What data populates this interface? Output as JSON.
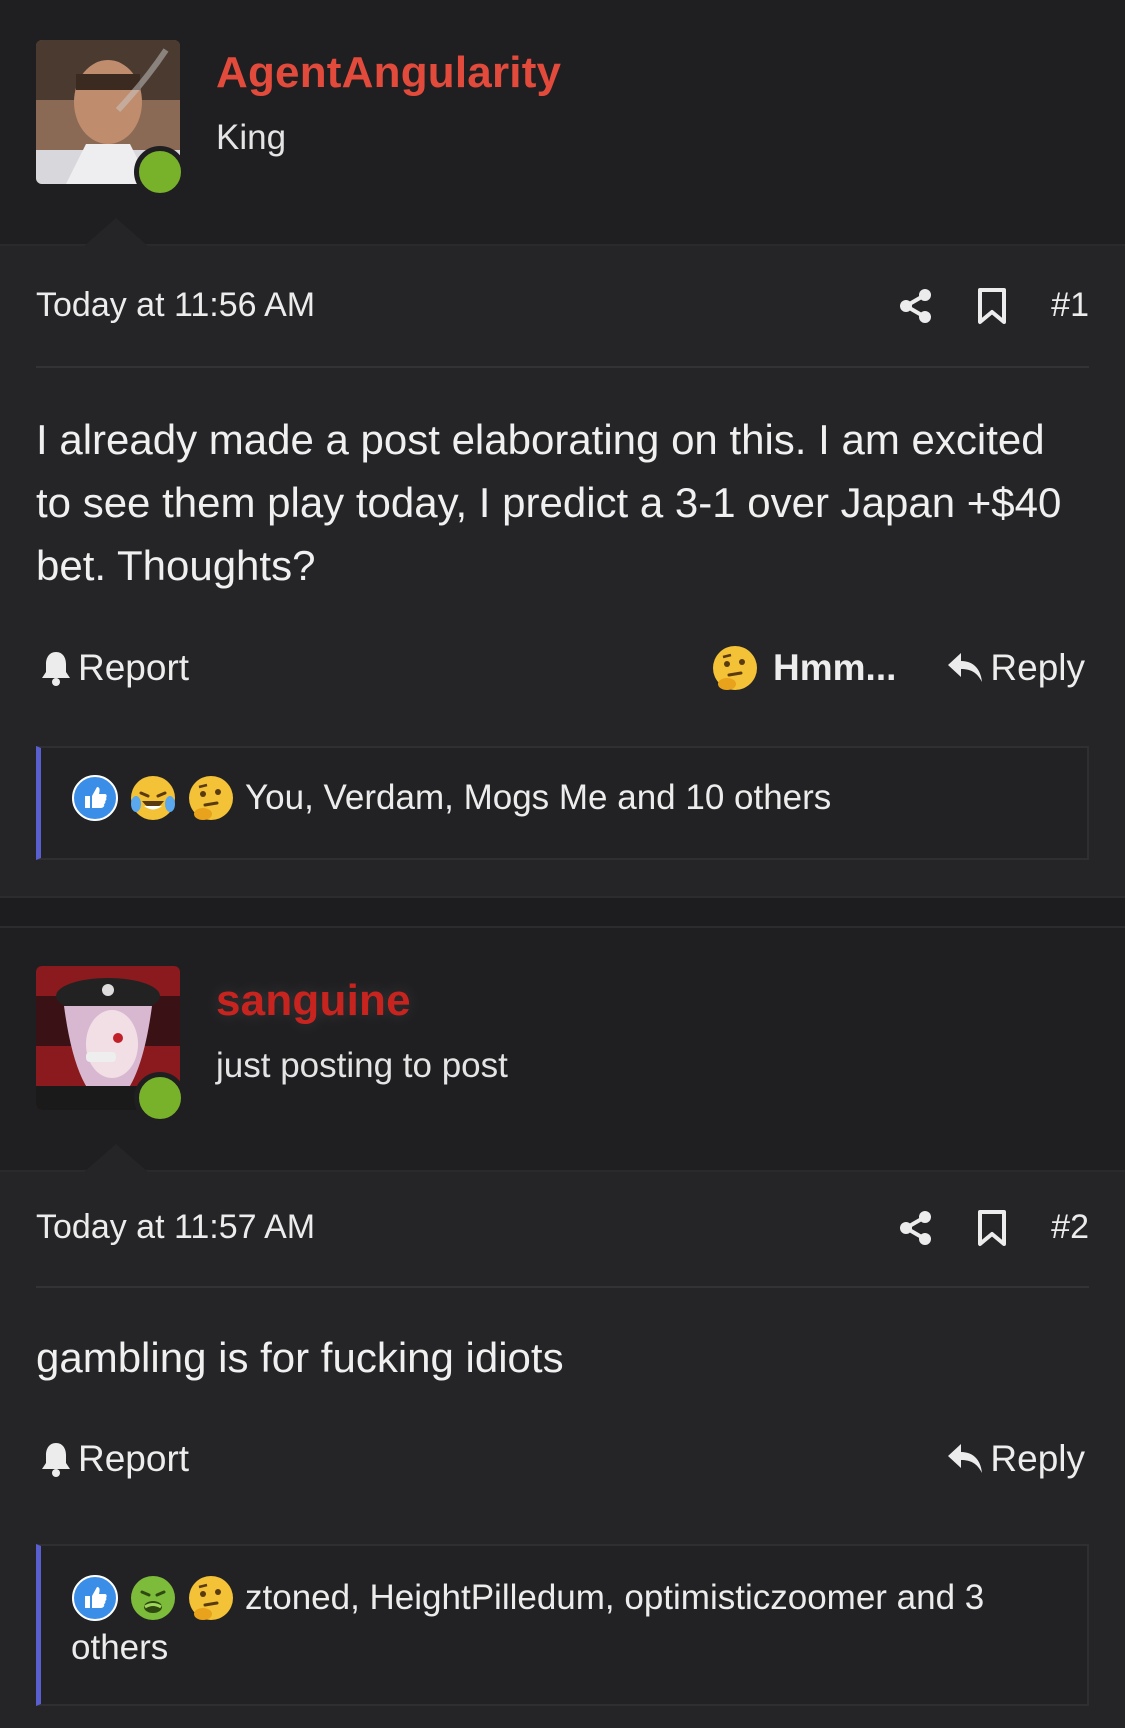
{
  "posts": [
    {
      "username": "AgentAngularity",
      "username_color": "#e24b3c",
      "user_title": "King",
      "timestamp": "Today at 11:56 AM",
      "post_number": "#1",
      "message": "I already made a post elaborating on this. I am excited to see them play today, I predict a 3-1 over Japan +$40 bet. Thoughts?",
      "report_label": "Report",
      "reaction_label": "Hmm...",
      "reply_label": "Reply",
      "reactions": [
        "like-emoji",
        "laughing-crying-emoji",
        "thinking-emoji"
      ],
      "reactions_text": "You, Verdam, Mogs Me and 10 others"
    },
    {
      "username": "sanguine",
      "username_color": "#c8241f",
      "user_title": "just posting to post",
      "timestamp": "Today at 11:57 AM",
      "post_number": "#2",
      "message": "gambling is for fucking idiots",
      "report_label": "Report",
      "reply_label": "Reply",
      "reactions": [
        "like-emoji",
        "sick-emoji",
        "thinking-emoji"
      ],
      "reactions_text": "ztoned, HeightPilledum, optimisticzoomer and 3 others"
    }
  ],
  "colors": {
    "online": "#78b12a",
    "accent_bar": "#5a5fd0",
    "background": "#1d1d1f"
  }
}
